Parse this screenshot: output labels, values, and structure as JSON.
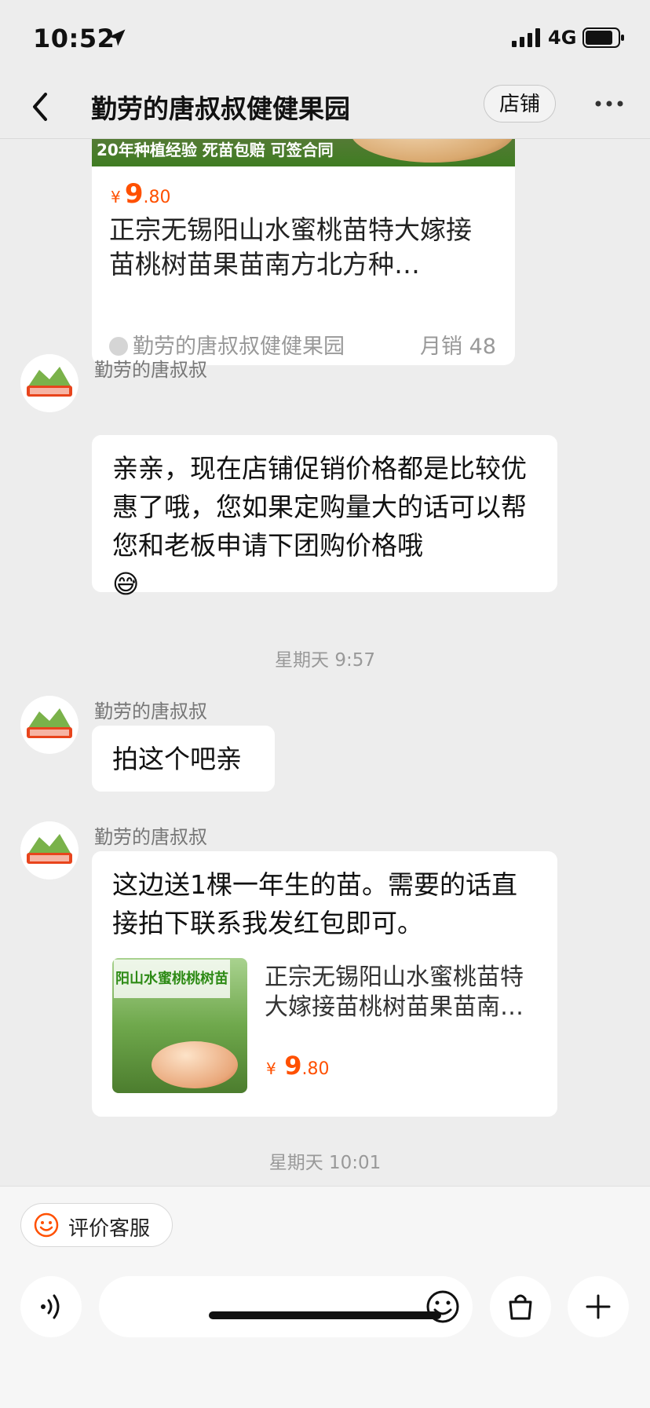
{
  "status": {
    "time": "10:52",
    "network": "4G"
  },
  "nav": {
    "title": "勤劳的唐叔叔健健果园",
    "shop_label": "店铺"
  },
  "product_card": {
    "banner": "20年种植经验 死苗包赔 可签合同",
    "price_currency": "¥",
    "price_int": "9",
    "price_dec": ".80",
    "title": "正宗无锡阳山水蜜桃苗特大嫁接苗桃树苗果苗南方北方种…",
    "shop": "勤劳的唐叔叔健健果园",
    "sales": "月销 48"
  },
  "messages": [
    {
      "sender": "勤劳的唐叔叔",
      "text": "亲亲，现在店铺促销价格都是比较优惠了哦，您如果定购量大的话可以帮您和老板申请下团购价格哦",
      "emoji": "😅"
    },
    {
      "sender": "勤劳的唐叔叔",
      "text": "拍这个吧亲"
    },
    {
      "sender": "勤劳的唐叔叔",
      "text": "这边送1棵一年生的苗。需要的话直接拍下联系我发红包即可。",
      "card": {
        "image_label": "阳山水蜜桃桃树苗",
        "title": "正宗无锡阳山水蜜桃苗特大嫁接苗桃树苗果苗南…",
        "price_currency": "¥",
        "price_int": "9",
        "price_dec": ".80"
      }
    }
  ],
  "timestamps": [
    "星期天 9:57",
    "星期天 10:01"
  ],
  "bottom": {
    "rate_label": "评价客服",
    "input_placeholder": ""
  },
  "icons": [
    "location-arrow-icon",
    "signal-icon",
    "battery-icon",
    "back-chevron-icon",
    "more-dots-icon",
    "smile-icon",
    "voice-icon",
    "emoji-icon",
    "shopping-bag-icon",
    "plus-icon"
  ],
  "colors": {
    "accent": "#ff5000",
    "background": "#ededed"
  }
}
